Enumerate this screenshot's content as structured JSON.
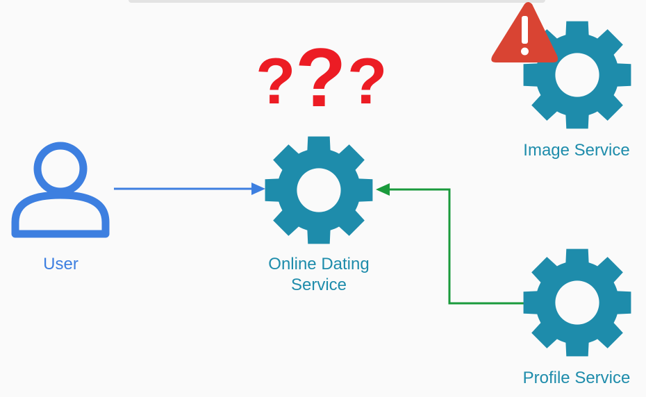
{
  "nodes": {
    "user": {
      "label": "User",
      "icon": "user-icon"
    },
    "online_dating": {
      "label_line1": "Online Dating",
      "label_line2": "Service",
      "icon": "gear-icon"
    },
    "image": {
      "label": "Image Service",
      "icon": "gear-icon",
      "status": "warning-icon"
    },
    "profile": {
      "label": "Profile Service",
      "icon": "gear-icon"
    }
  },
  "question_marks": [
    "?",
    "?",
    "?"
  ],
  "edges": [
    {
      "from": "User",
      "to": "Online Dating Service",
      "color": "#3d7fe0"
    },
    {
      "from": "Profile Service",
      "to": "Online Dating Service",
      "color": "#1a9a3c"
    }
  ],
  "colors": {
    "gear": "#1e8cab",
    "user": "#3d7fe0",
    "warning": "#d94433",
    "question": "#ec1c24"
  }
}
